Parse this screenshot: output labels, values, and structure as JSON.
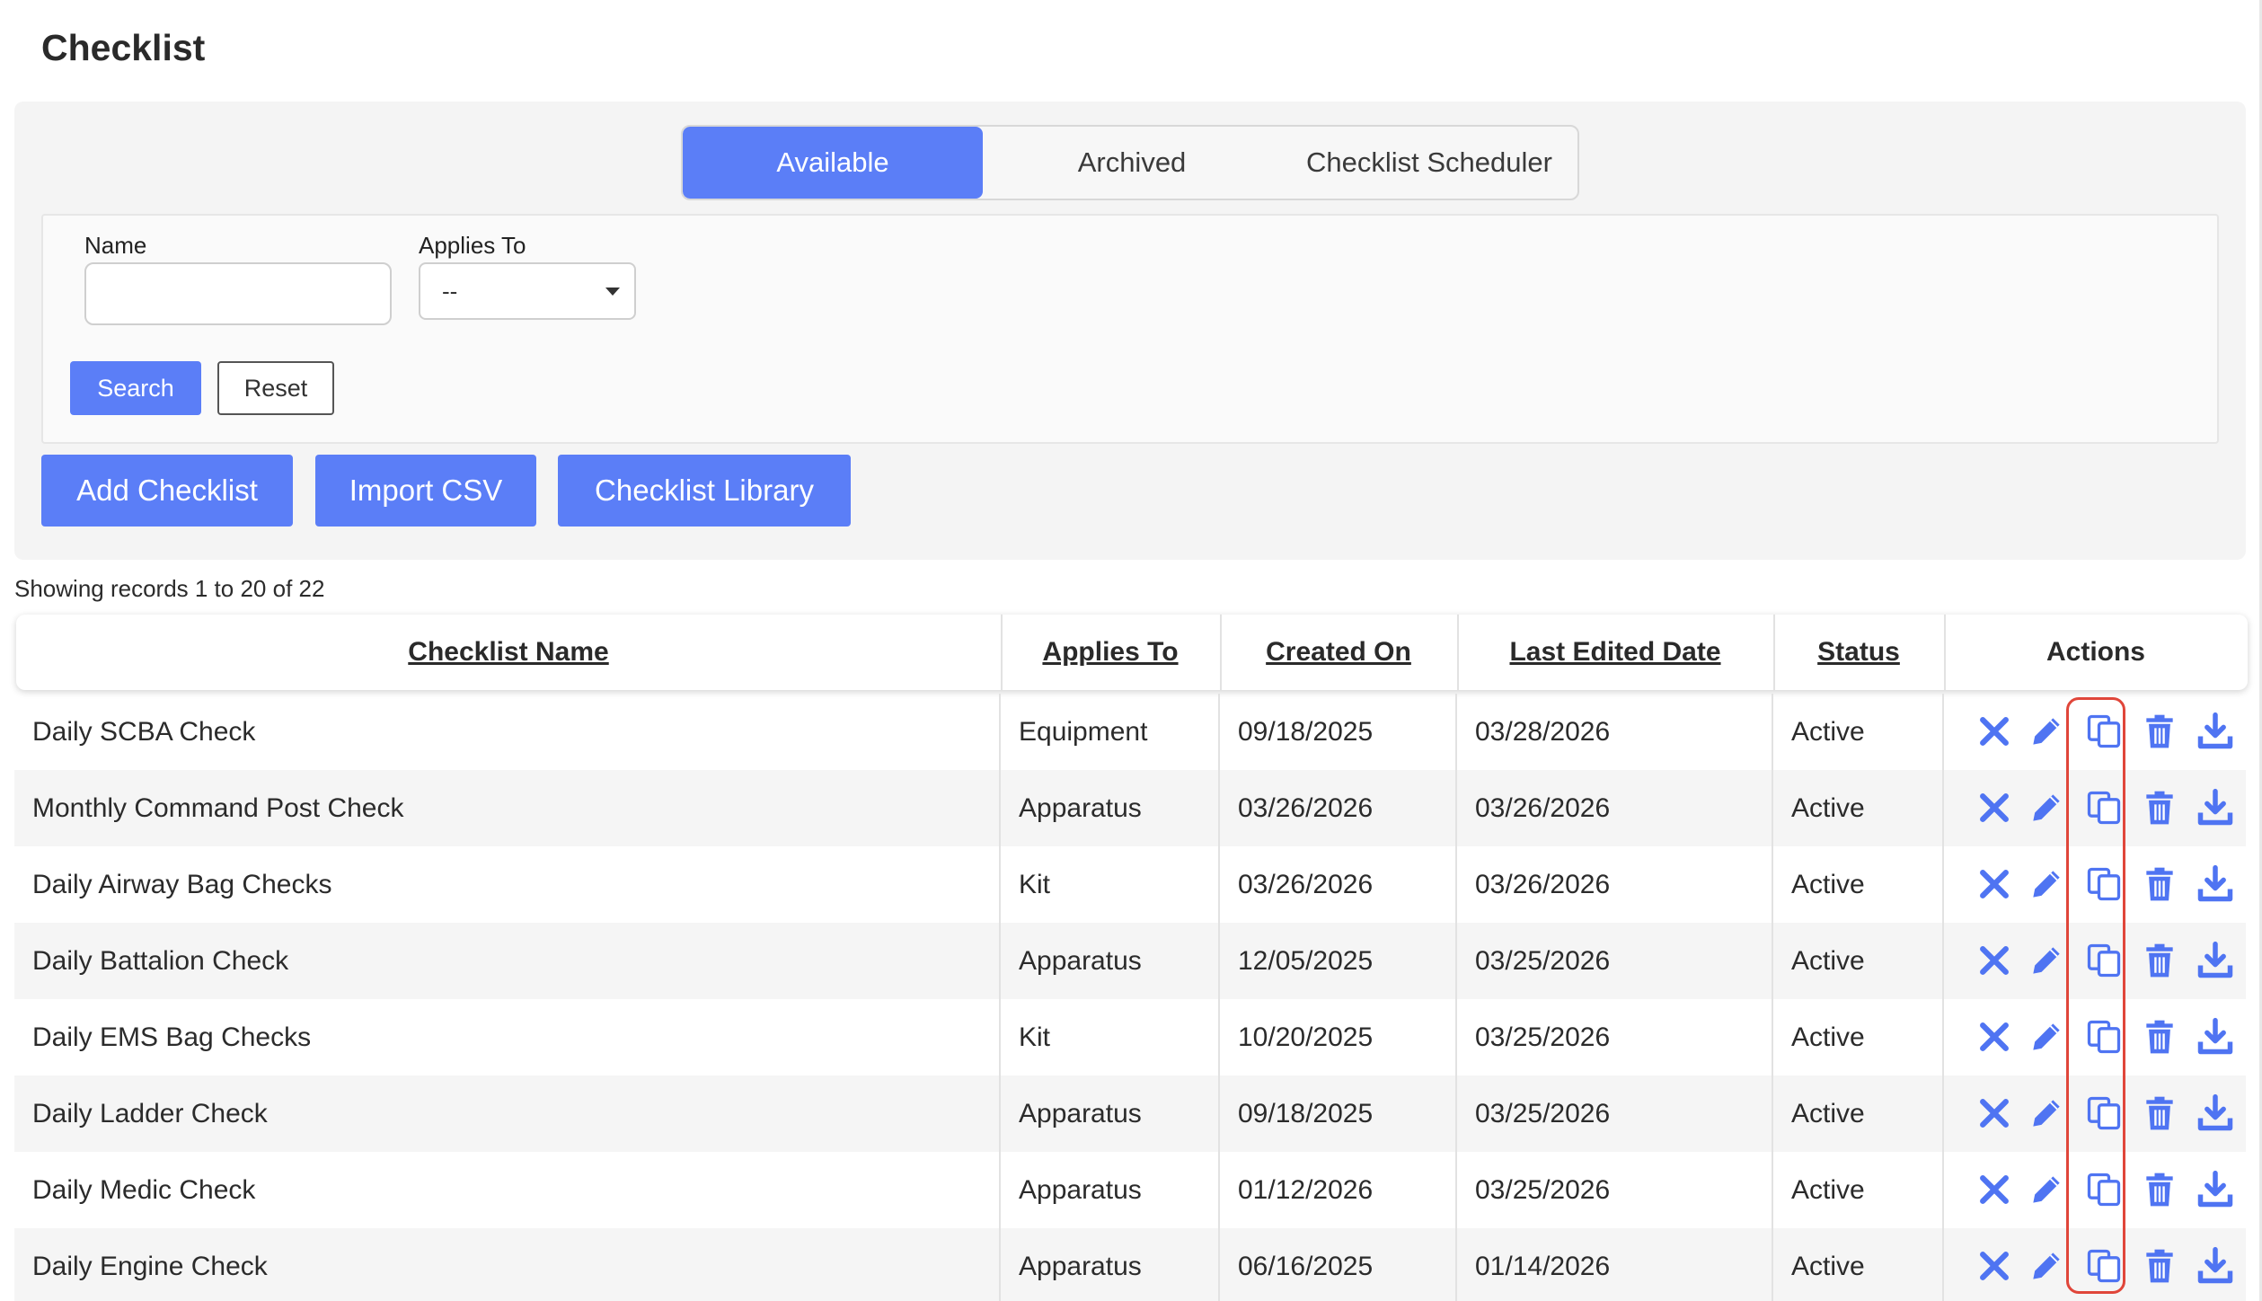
{
  "page": {
    "title": "Checklist"
  },
  "tabs": [
    {
      "label": "Available",
      "active": true
    },
    {
      "label": "Archived",
      "active": false
    },
    {
      "label": "Checklist Scheduler",
      "active": false
    }
  ],
  "filters": {
    "name_label": "Name",
    "name_value": "",
    "applies_label": "Applies To",
    "applies_value": "--",
    "search_label": "Search",
    "reset_label": "Reset"
  },
  "buttons": {
    "add": "Add Checklist",
    "import": "Import CSV",
    "library": "Checklist Library"
  },
  "records_info": "Showing records 1 to 20 of 22",
  "table": {
    "headers": [
      "Checklist Name",
      "Applies To",
      "Created On",
      "Last Edited Date",
      "Status",
      "Actions"
    ],
    "rows": [
      {
        "name": "Daily SCBA Check",
        "applies": "Equipment",
        "created": "09/18/2025",
        "edited": "03/28/2026",
        "status": "Active"
      },
      {
        "name": "Monthly Command Post Check",
        "applies": "Apparatus",
        "created": "03/26/2026",
        "edited": "03/26/2026",
        "status": "Active"
      },
      {
        "name": "Daily Airway Bag Checks",
        "applies": "Kit",
        "created": "03/26/2026",
        "edited": "03/26/2026",
        "status": "Active"
      },
      {
        "name": "Daily Battalion Check",
        "applies": "Apparatus",
        "created": "12/05/2025",
        "edited": "03/25/2026",
        "status": "Active"
      },
      {
        "name": "Daily EMS Bag Checks",
        "applies": "Kit",
        "created": "10/20/2025",
        "edited": "03/25/2026",
        "status": "Active"
      },
      {
        "name": "Daily Ladder Check",
        "applies": "Apparatus",
        "created": "09/18/2025",
        "edited": "03/25/2026",
        "status": "Active"
      },
      {
        "name": "Daily Medic Check",
        "applies": "Apparatus",
        "created": "01/12/2026",
        "edited": "03/25/2026",
        "status": "Active"
      },
      {
        "name": "Daily Engine Check",
        "applies": "Apparatus",
        "created": "06/16/2025",
        "edited": "01/14/2026",
        "status": "Active"
      }
    ]
  },
  "icons": {
    "actions": [
      "close-icon",
      "pencil-icon",
      "copy-icon",
      "trash-icon",
      "download-icon"
    ],
    "color": "#4f74f2"
  },
  "colors": {
    "primary": "#5b7ef7",
    "highlight": "#e0463a"
  }
}
